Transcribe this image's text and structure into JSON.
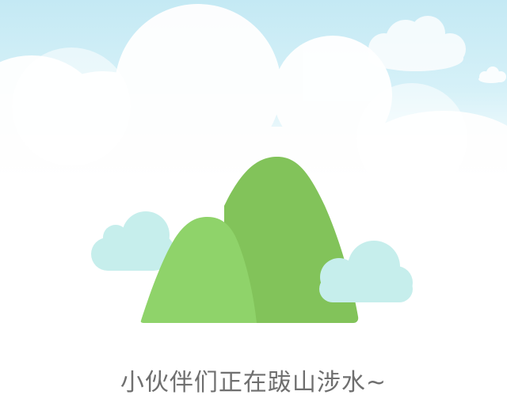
{
  "empty_state": {
    "message": "小伙伴们正在跋山涉水~",
    "illustration": {
      "icon": "mountain-icon",
      "sky_top_color": "#c7eaf5",
      "sky_bottom_color": "#ffffff",
      "cloud_color": "#ffffff",
      "small_cloud_color": "#c6eeec",
      "mountain_back_color": "#82c35a",
      "mountain_front_color": "#8fd36a",
      "text_color": "#6f6f6f"
    }
  }
}
